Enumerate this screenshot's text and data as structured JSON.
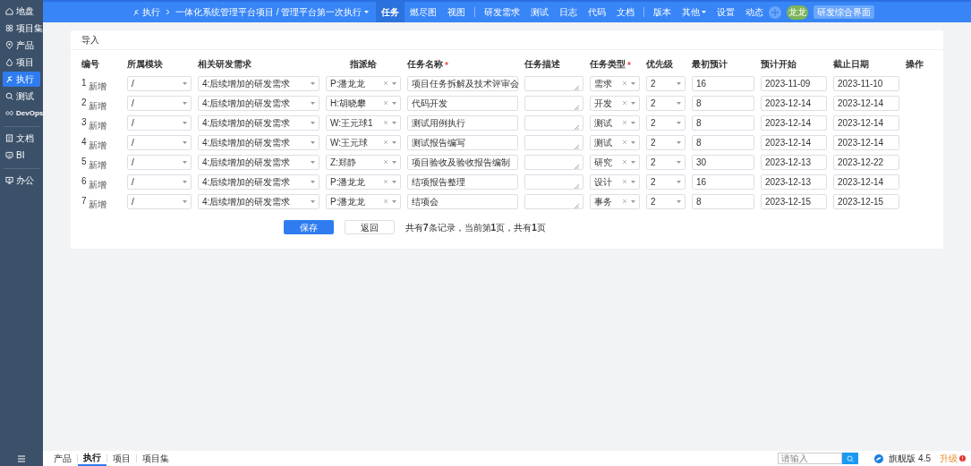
{
  "sidebar": {
    "items": [
      {
        "label": "地盘",
        "selected": false
      },
      {
        "label": "项目集",
        "selected": false
      },
      {
        "label": "产品",
        "selected": false
      },
      {
        "label": "项目",
        "selected": false
      },
      {
        "label": "执行",
        "selected": true
      },
      {
        "label": "测试",
        "selected": false
      },
      {
        "label": "DevOps",
        "selected": false
      },
      {
        "label": "文档",
        "selected": false
      },
      {
        "label": "BI",
        "selected": false
      },
      {
        "label": "办公",
        "selected": false
      }
    ]
  },
  "topbar": {
    "breadcrumb": [
      "执行",
      "一体化系统管理平台项目 / 管理平台第一次执行"
    ],
    "nav_groups": [
      [
        {
          "label": "任务",
          "selected": true,
          "dropdown": false
        },
        {
          "label": "燃尽图",
          "selected": false,
          "dropdown": false
        },
        {
          "label": "视图",
          "selected": false,
          "dropdown": false
        }
      ],
      [
        {
          "label": "研发需求",
          "selected": false,
          "dropdown": false
        },
        {
          "label": "测试",
          "selected": false,
          "dropdown": false
        },
        {
          "label": "日志",
          "selected": false,
          "dropdown": false
        },
        {
          "label": "代码",
          "selected": false,
          "dropdown": false
        },
        {
          "label": "文档",
          "selected": false,
          "dropdown": false
        }
      ],
      [
        {
          "label": "版本",
          "selected": false,
          "dropdown": false
        },
        {
          "label": "其他",
          "selected": false,
          "dropdown": true
        },
        {
          "label": "设置",
          "selected": false,
          "dropdown": false
        },
        {
          "label": "动态",
          "selected": false,
          "dropdown": false
        }
      ]
    ],
    "avatar": "龙龙",
    "switch_button": "研发综合界面"
  },
  "card": {
    "title": "导入",
    "columns": [
      {
        "kind": "index",
        "label": "编号",
        "required": false
      },
      {
        "kind": "module",
        "label": "所属模块",
        "required": false
      },
      {
        "kind": "story",
        "label": "相关研发需求",
        "required": false
      },
      {
        "kind": "assignee",
        "label": "指派给",
        "required": false
      },
      {
        "kind": "name",
        "label": "任务名称",
        "required": true
      },
      {
        "kind": "desc",
        "label": "任务描述",
        "required": false
      },
      {
        "kind": "type",
        "label": "任务类型",
        "required": true
      },
      {
        "kind": "priority",
        "label": "优先级",
        "required": false
      },
      {
        "kind": "estimate",
        "label": "最初预计",
        "required": false
      },
      {
        "kind": "start",
        "label": "预计开始",
        "required": false
      },
      {
        "kind": "deadline",
        "label": "截止日期",
        "required": false
      },
      {
        "kind": "actions",
        "label": "操作",
        "required": false
      }
    ],
    "rows": [
      {
        "number": "1",
        "tag": "新增",
        "module": "/",
        "story": "4:后续增加的研发需求",
        "assignee": "P:潘龙龙",
        "name": "项目任务拆解及技术评审会",
        "type": "需求",
        "priority": "2",
        "estimate": "16",
        "start": "2023-11-09",
        "deadline": "2023-11-10"
      },
      {
        "number": "2",
        "tag": "新增",
        "module": "/",
        "story": "4:后续增加的研发需求",
        "assignee": "H:胡晓攀",
        "name": "代码开发",
        "type": "开发",
        "priority": "2",
        "estimate": "8",
        "start": "2023-12-14",
        "deadline": "2023-12-14"
      },
      {
        "number": "3",
        "tag": "新增",
        "module": "/",
        "story": "4:后续增加的研发需求",
        "assignee": "W:王元球1",
        "name": "测试用例执行",
        "type": "测试",
        "priority": "2",
        "estimate": "8",
        "start": "2023-12-14",
        "deadline": "2023-12-14"
      },
      {
        "number": "4",
        "tag": "新增",
        "module": "/",
        "story": "4:后续增加的研发需求",
        "assignee": "W:王元球",
        "name": "测试报告编写",
        "type": "测试",
        "priority": "2",
        "estimate": "8",
        "start": "2023-12-14",
        "deadline": "2023-12-14"
      },
      {
        "number": "5",
        "tag": "新增",
        "module": "/",
        "story": "4:后续增加的研发需求",
        "assignee": "Z:郑静",
        "name": "项目验收及验收报告编制",
        "type": "研究",
        "priority": "2",
        "estimate": "30",
        "start": "2023-12-13",
        "deadline": "2023-12-22"
      },
      {
        "number": "6",
        "tag": "新增",
        "module": "/",
        "story": "4:后续增加的研发需求",
        "assignee": "P:潘龙龙",
        "name": "结项报告整理",
        "type": "设计",
        "priority": "2",
        "estimate": "16",
        "start": "2023-12-13",
        "deadline": "2023-12-14"
      },
      {
        "number": "7",
        "tag": "新增",
        "module": "/",
        "story": "4:后续增加的研发需求",
        "assignee": "P:潘龙龙",
        "name": "结项会",
        "type": "事务",
        "priority": "2",
        "estimate": "8",
        "start": "2023-12-15",
        "deadline": "2023-12-15"
      }
    ],
    "save_button": "保存",
    "back_button": "返回",
    "pager": "共有**7**条记录，当前第**1**页，共有**1**页"
  },
  "bottom_bar": {
    "tabs": [
      {
        "label": "产品",
        "selected": false
      },
      {
        "label": "执行",
        "selected": true
      },
      {
        "label": "项目",
        "selected": false
      },
      {
        "label": "项目集",
        "selected": false
      }
    ],
    "search": {
      "placeholder": "请输入"
    },
    "version": "旗舰版 4.5",
    "upgrade": "升级"
  }
}
